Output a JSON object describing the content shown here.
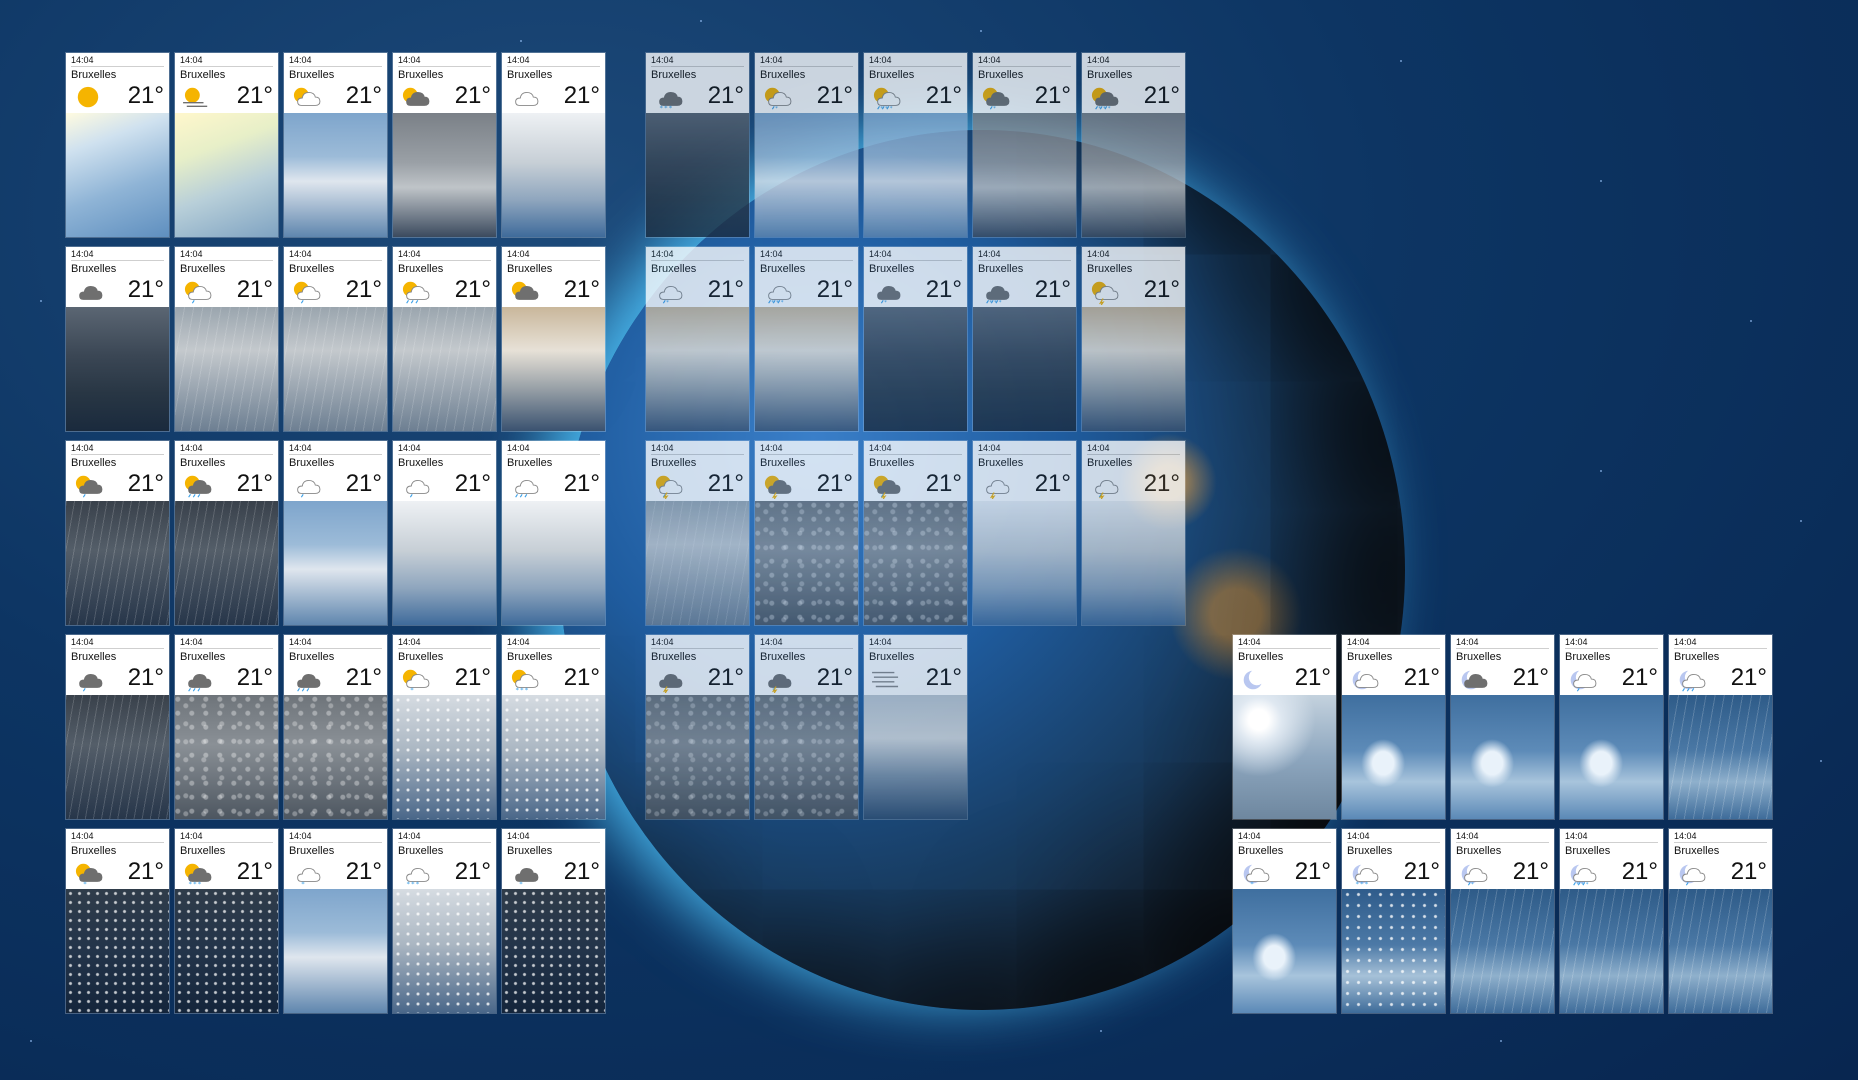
{
  "common": {
    "time": "14:04",
    "city": "Bruxelles",
    "temp": "21°"
  },
  "colors": {
    "sun": "#f5b400",
    "cloud_dark": "#6f6f6f",
    "cloud_light": "#ffffff",
    "precip": "#3aa0e8",
    "moon": "#b9c7f0"
  },
  "groups": [
    {
      "name": "group-day",
      "cards": [
        {
          "icon": "sun",
          "scene": "scene-sunny"
        },
        {
          "icon": "sun-haze",
          "scene": "scene-sunhaze"
        },
        {
          "icon": "sun-cloud",
          "scene": "scene-cloudy-blue"
        },
        {
          "icon": "sun-dark-cloud",
          "scene": "scene-grey"
        },
        {
          "icon": "cloud-outline",
          "scene": "scene-overcast"
        },
        {
          "icon": "dark-cloud",
          "scene": "scene-dark"
        },
        {
          "icon": "sun-cloud-rain",
          "scene": "scene-rain"
        },
        {
          "icon": "sun-cloud-rain",
          "scene": "scene-rain"
        },
        {
          "icon": "sun-cloud-heavy-rain",
          "scene": "scene-rain"
        },
        {
          "icon": "sun-dark-cloud",
          "scene": "scene-storm"
        },
        {
          "icon": "sun-dark-cloud-rain",
          "scene": "scene-rain-dark"
        },
        {
          "icon": "sun-dark-cloud-heavy-rain",
          "scene": "scene-rain-dark"
        },
        {
          "icon": "cloud-outline-rain",
          "scene": "scene-cloudy-blue"
        },
        {
          "icon": "cloud-outline-rain",
          "scene": "scene-overcast"
        },
        {
          "icon": "cloud-outline-heavy-rain",
          "scene": "scene-overcast"
        },
        {
          "icon": "dark-cloud-rain",
          "scene": "scene-rain-dark"
        },
        {
          "icon": "dark-cloud-heavy-rain",
          "scene": "scene-drops"
        },
        {
          "icon": "dark-cloud-heavy-rain",
          "scene": "scene-drops"
        },
        {
          "icon": "sun-cloud-snow",
          "scene": "scene-snow"
        },
        {
          "icon": "sun-cloud-heavy-snow",
          "scene": "scene-snow"
        },
        {
          "icon": "sun-dark-cloud-snow",
          "scene": "scene-snow-dark"
        },
        {
          "icon": "sun-dark-cloud-heavy-snow",
          "scene": "scene-snow-dark"
        },
        {
          "icon": "cloud-outline-snow",
          "scene": "scene-cloudy-blue"
        },
        {
          "icon": "cloud-outline-heavy-snow",
          "scene": "scene-snow"
        },
        {
          "icon": "dark-cloud-snow",
          "scene": "scene-snow-dark"
        }
      ]
    },
    {
      "name": "group-day-translucent",
      "cards": [
        {
          "icon": "dark-cloud-heavy-snow",
          "scene": "scene-dark"
        },
        {
          "icon": "sun-cloud-sleet",
          "scene": "scene-cloudy-blue"
        },
        {
          "icon": "sun-cloud-heavy-sleet",
          "scene": "scene-cloudy-blue"
        },
        {
          "icon": "sun-dark-cloud-sleet",
          "scene": "scene-grey"
        },
        {
          "icon": "sun-dark-cloud-heavy-sleet",
          "scene": "scene-grey"
        },
        {
          "icon": "cloud-outline-sleet",
          "scene": "scene-storm"
        },
        {
          "icon": "cloud-outline-heavy-sleet",
          "scene": "scene-storm"
        },
        {
          "icon": "dark-cloud-sleet",
          "scene": "scene-dark"
        },
        {
          "icon": "dark-cloud-heavy-sleet",
          "scene": "scene-dark"
        },
        {
          "icon": "sun-cloud-thunder",
          "scene": "scene-storm"
        },
        {
          "icon": "sun-cloud-thunder-rain",
          "scene": "scene-rain"
        },
        {
          "icon": "sun-dark-cloud-thunder",
          "scene": "scene-drops"
        },
        {
          "icon": "sun-dark-cloud-thunder-rain",
          "scene": "scene-drops"
        },
        {
          "icon": "cloud-outline-thunder",
          "scene": "scene-overcast"
        },
        {
          "icon": "cloud-outline-thunder-rain",
          "scene": "scene-overcast"
        },
        {
          "icon": "dark-cloud-thunder",
          "scene": "scene-drops"
        },
        {
          "icon": "dark-cloud-thunder-snow",
          "scene": "scene-drops"
        },
        {
          "icon": "fog",
          "scene": "scene-fog"
        }
      ]
    },
    {
      "name": "group-night",
      "cards": [
        {
          "icon": "moon",
          "scene": "scene-night-moon"
        },
        {
          "icon": "moon-cloud",
          "scene": "scene-night-cloud"
        },
        {
          "icon": "moon-dark-cloud",
          "scene": "scene-night-cloud"
        },
        {
          "icon": "moon-cloud-rain",
          "scene": "scene-night-cloud"
        },
        {
          "icon": "moon-cloud-heavy-rain",
          "scene": "scene-night-rain"
        },
        {
          "icon": "moon-cloud-snow",
          "scene": "scene-night-cloud"
        },
        {
          "icon": "moon-cloud-heavy-snow",
          "scene": "scene-night-snow"
        },
        {
          "icon": "moon-cloud-sleet",
          "scene": "scene-night-rain"
        },
        {
          "icon": "moon-cloud-heavy-sleet",
          "scene": "scene-night-rain"
        },
        {
          "icon": "moon-cloud-rain",
          "scene": "scene-night-rain"
        }
      ]
    }
  ]
}
